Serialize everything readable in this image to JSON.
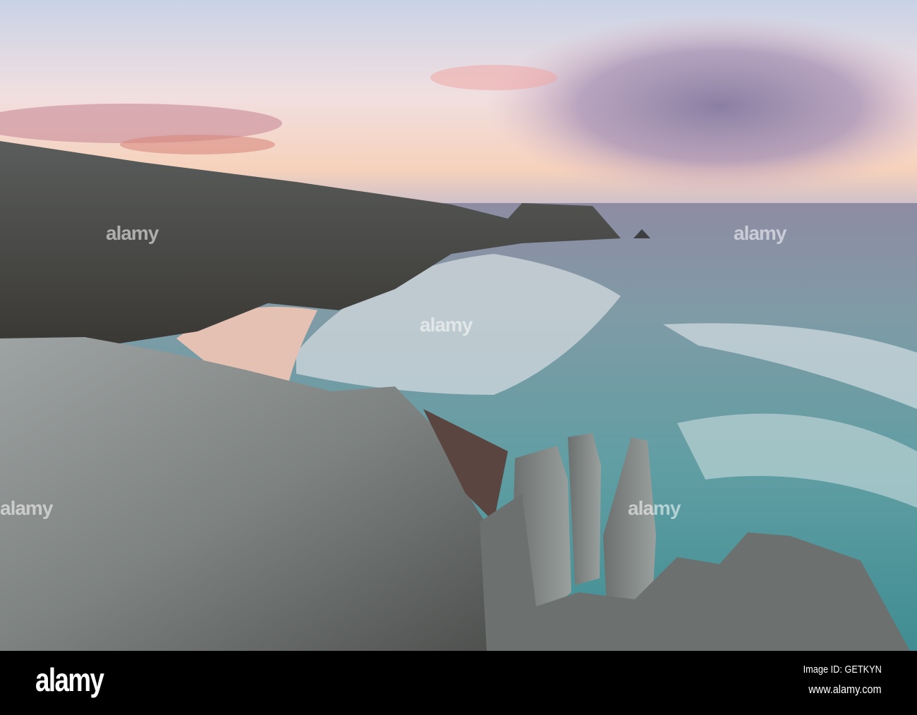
{
  "photo": {
    "subject": "Cliffs and cove at sunset",
    "watermark_text": "alamy"
  },
  "footer": {
    "logo": "alamy",
    "image_id": "Image ID: GETKYN",
    "url": "www.alamy.com"
  }
}
